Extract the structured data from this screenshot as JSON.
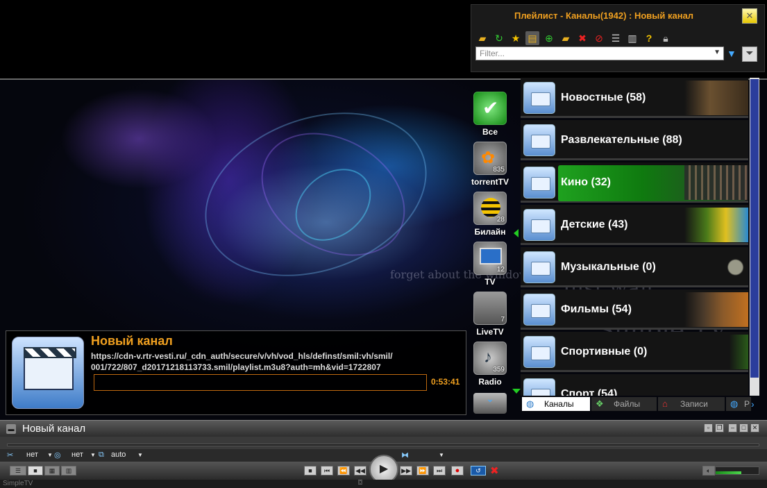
{
  "playlist": {
    "title": "Плейлист - Каналы(1942) : Новый канал",
    "filter_placeholder": "Filter...",
    "toolbar": [
      "folder-open-icon",
      "refresh-icon",
      "favorite-star-icon",
      "tree-view-icon",
      "add-icon",
      "new-folder-icon",
      "delete-icon",
      "block-icon",
      "list-view-icon",
      "columns-icon",
      "help-icon",
      "lock-icon"
    ]
  },
  "sources": [
    {
      "label": "Все",
      "count": ""
    },
    {
      "label": "torrentTV",
      "count": "835"
    },
    {
      "label": "Билайн",
      "count": "28"
    },
    {
      "label": "TV",
      "count": "12"
    },
    {
      "label": "LiveTV",
      "count": "7"
    },
    {
      "label": "Radio",
      "count": "359"
    }
  ],
  "categories": [
    {
      "name": "Новостные (58)"
    },
    {
      "name": "Развлекательные (88)"
    },
    {
      "name": "Кино (32)"
    },
    {
      "name": "Детские (43)"
    },
    {
      "name": "Музыкальные (0)"
    },
    {
      "name": "Фильмы (54)"
    },
    {
      "name": "Спортивные (0)"
    },
    {
      "name": "Спорт (54)"
    }
  ],
  "tabs": [
    {
      "label": "Каналы"
    },
    {
      "label": "Файлы"
    },
    {
      "label": "Записи"
    },
    {
      "label": "Р"
    }
  ],
  "info": {
    "channel_name": "Новый канал",
    "url_line1": "https://cdn-v.rtr-vesti.ru/_cdn_auth/secure/v/vh/vod_hls/definst/smil:vh/smil/",
    "url_line2": "001/722/807_d20171218113733.smil/playlist.m3u8?auth=mh&vid=1722807",
    "time": "0:53:41"
  },
  "watermark": {
    "line1": "forget about the window and wait",
    "line2": "Just wait",
    "line3": "Simple TV"
  },
  "player": {
    "title": "Новый канал",
    "opt_audio": "нет",
    "opt_sub": "нет",
    "opt_aspect": "auto",
    "status": "SimpleTV",
    "volume": 0.6
  }
}
